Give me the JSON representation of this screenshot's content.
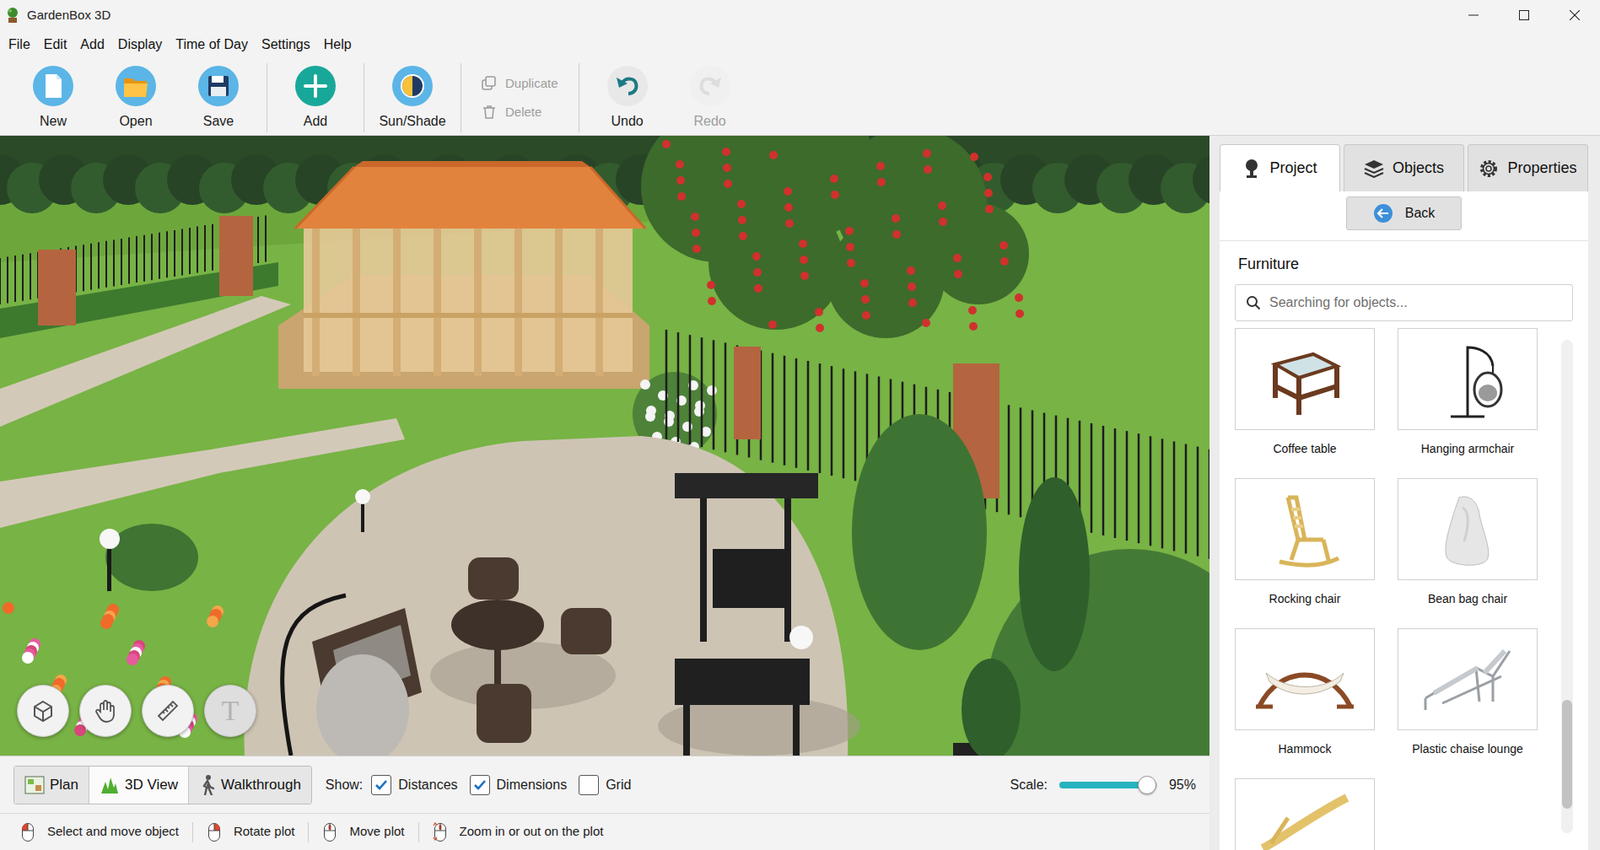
{
  "window": {
    "title": "GardenBox 3D"
  },
  "menu": [
    "File",
    "Edit",
    "Add",
    "Display",
    "Time of Day",
    "Settings",
    "Help"
  ],
  "toolbar": [
    [
      {
        "label": "New",
        "disabled": false,
        "kind": "big"
      },
      {
        "label": "Open",
        "disabled": false,
        "kind": "big"
      },
      {
        "label": "Save",
        "disabled": false,
        "kind": "big"
      }
    ],
    [
      {
        "label": "Add",
        "disabled": false,
        "kind": "big"
      }
    ],
    [
      {
        "label": "Sun/Shade",
        "disabled": false,
        "kind": "big"
      }
    ],
    [
      {
        "label": "Duplicate",
        "disabled": true,
        "kind": "small"
      },
      {
        "label": "Delete",
        "disabled": true,
        "kind": "small"
      }
    ],
    [
      {
        "label": "Undo",
        "disabled": false,
        "kind": "big"
      },
      {
        "label": "Redo",
        "disabled": true,
        "kind": "big"
      }
    ]
  ],
  "view_tools": [
    {
      "disabled": false
    },
    {
      "disabled": false
    },
    {
      "disabled": false
    },
    {
      "glyph": "T",
      "disabled": true
    }
  ],
  "view_modes": [
    {
      "label": "Plan",
      "selected": false
    },
    {
      "label": "3D View",
      "selected": true
    },
    {
      "label": "Walkthrough",
      "selected": false
    }
  ],
  "show": {
    "label": "Show:",
    "options": [
      {
        "label": "Distances",
        "checked": true
      },
      {
        "label": "Dimensions",
        "checked": true
      },
      {
        "label": "Grid",
        "checked": false
      }
    ]
  },
  "scale": {
    "label": "Scale:",
    "level": 0.9,
    "reading": "95%"
  },
  "status_bar": [
    "Select and move object",
    "Rotate plot",
    "Move plot",
    "Zoom in or out on the plot"
  ],
  "panel": {
    "tabs": [
      {
        "label": "Project",
        "selected": true
      },
      {
        "label": "Objects",
        "selected": false
      },
      {
        "label": "Properties",
        "selected": false
      }
    ],
    "back": "Back",
    "category": "Furniture",
    "search": {
      "placeholder": "Searching for objects..."
    },
    "items": [
      {
        "label": "Coffee table"
      },
      {
        "label": "Hanging armchair"
      },
      {
        "label": "Rocking chair"
      },
      {
        "label": "Bean bag chair"
      },
      {
        "label": "Hammock"
      },
      {
        "label": "Plastic chaise lounge"
      },
      {
        "cut": true
      }
    ],
    "scroll": {
      "level": 0.22,
      "position": 0.73
    }
  }
}
